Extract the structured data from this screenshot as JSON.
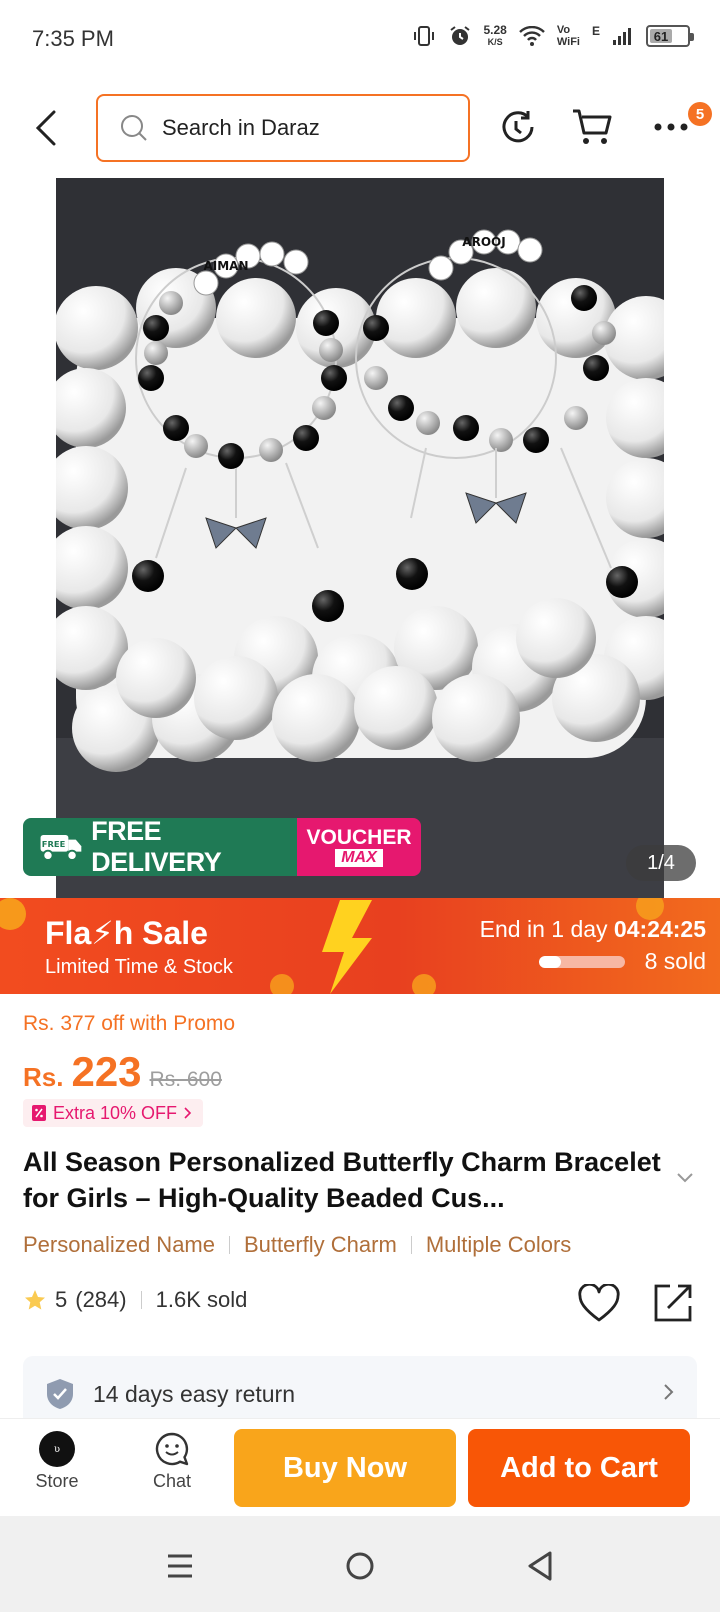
{
  "status_bar": {
    "time": "7:35 PM",
    "net_speed": "5.28",
    "net_unit": "K/S",
    "vowifi_top": "Vo",
    "vowifi_bottom": "WiFi",
    "network_type": "E",
    "battery": "61"
  },
  "header": {
    "search_placeholder": "Search in Daraz",
    "more_badge": "5"
  },
  "gallery": {
    "bracelet_names": [
      "AIMAN",
      "AROOJ"
    ],
    "free_delivery": "FREE DELIVERY",
    "free_icon_text": "FREE",
    "voucher_top": "VOUCHER",
    "voucher_bottom": "MAX",
    "pager": "1/4"
  },
  "flash_sale": {
    "title": "Fla⚡h Sale",
    "subtitle": "Limited Time & Stock",
    "ends_prefix": "End in 1 day ",
    "countdown": "04:24:25",
    "sold": "8 sold",
    "sold_fraction": 0.25
  },
  "price": {
    "promo": "Rs. 377 off with Promo",
    "currency": "Rs.",
    "current": "223",
    "original": "Rs. 600",
    "extra_off": "Extra 10% OFF"
  },
  "product": {
    "title": "All Season Personalized Butterfly Charm Bracelet for Girls – High-Quality Beaded Cus...",
    "tags": [
      "Personalized Name",
      "Butterfly Charm",
      "Multiple Colors"
    ],
    "rating": "5",
    "reviews": "(284)",
    "sold": "1.6K sold"
  },
  "return_policy": "14 days easy return",
  "bottom_bar": {
    "store_label": "Store",
    "chat_label": "Chat",
    "buy_now": "Buy Now",
    "add_to_cart": "Add to Cart"
  },
  "colors": {
    "accent": "#f57224",
    "buy_now": "#f9a51b",
    "add_to_cart": "#f85606",
    "free_delivery": "#1f7a55",
    "voucher": "#e6186f"
  }
}
